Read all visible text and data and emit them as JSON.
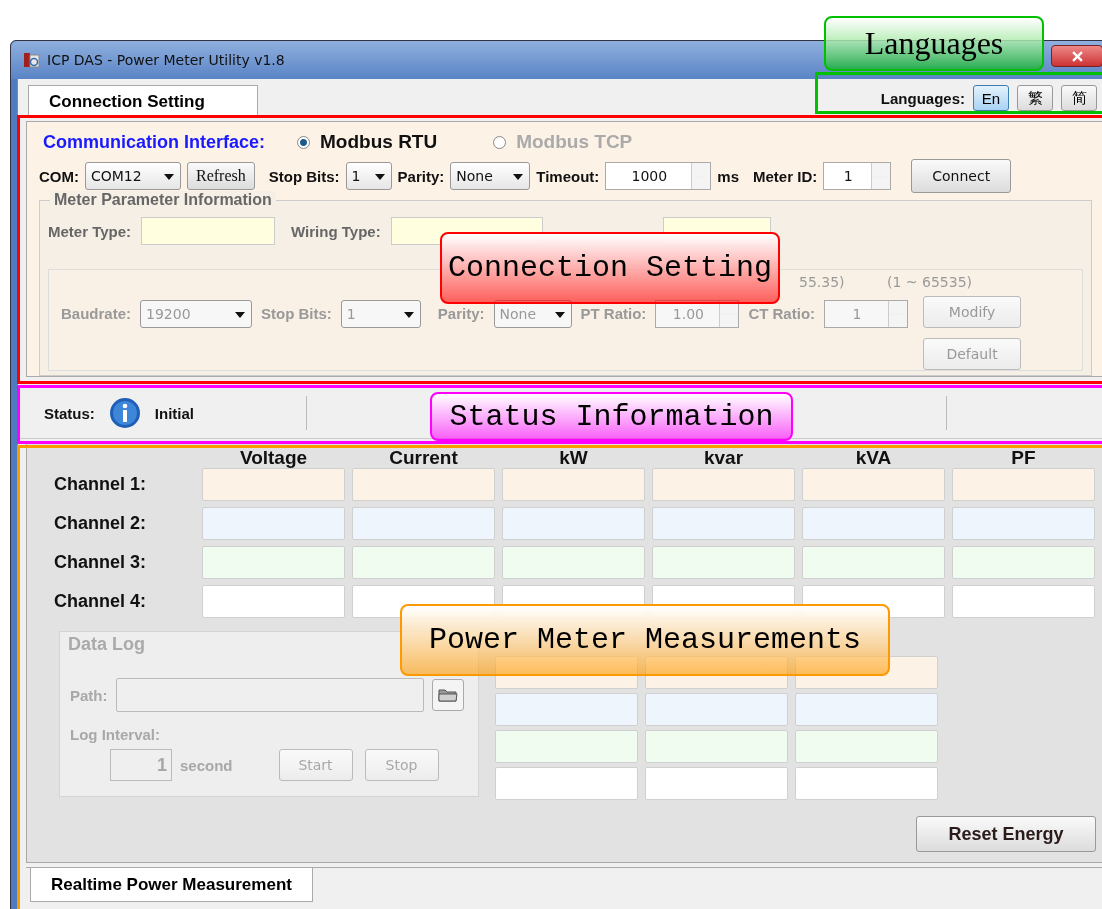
{
  "window": {
    "title": "ICP DAS  -  Power Meter Utility v1.8"
  },
  "top_tabs": [
    {
      "label": "Connection Setting",
      "selected": true
    }
  ],
  "languages": {
    "label": "Languages:",
    "options": [
      {
        "label": "En",
        "selected": true
      },
      {
        "label": "繁",
        "selected": false
      },
      {
        "label": "简",
        "selected": false
      }
    ]
  },
  "communication": {
    "label": "Communication Interface:",
    "options": [
      {
        "label": "Modbus RTU",
        "selected": true,
        "disabled": false
      },
      {
        "label": "Modbus TCP",
        "selected": false,
        "disabled": true
      }
    ]
  },
  "connection": {
    "com_label": "COM:",
    "com_value": "COM12",
    "refresh": "Refresh",
    "stop_bits_label": "Stop Bits:",
    "stop_bits_value": "1",
    "parity_label": "Parity:",
    "parity_value": "None",
    "timeout_label": "Timeout:",
    "timeout_value": "1000",
    "timeout_unit": "ms",
    "meter_id_label": "Meter ID:",
    "meter_id_value": "1",
    "connect": "Connect"
  },
  "meter_parameter": {
    "title": "Meter Parameter Information",
    "meter_type_label": "Meter Type:",
    "wiring_type_label": "Wiring Type:",
    "settings": {
      "disabled": true,
      "baudrate_label": "Baudrate:",
      "baudrate_value": "19200",
      "stop_bits_label": "Stop Bits:",
      "stop_bits_value": "1",
      "parity_label": "Parity:",
      "parity_value": "None",
      "pt_range": "55.35)",
      "pt_label": "PT Ratio:",
      "pt_value": "1.00",
      "ct_range": "(1 ~ 65535)",
      "ct_label": "CT Ratio:",
      "ct_value": "1",
      "modify": "Modify",
      "default": "Default"
    }
  },
  "status": {
    "label": "Status:",
    "value": "Initial"
  },
  "measurements": {
    "columns": [
      "Voltage",
      "Current",
      "kW",
      "kvar",
      "kVA",
      "PF"
    ],
    "rows": [
      {
        "label": "Channel 1:",
        "color": "#fcf3e6"
      },
      {
        "label": "Channel 2:",
        "color": "#eef5fc"
      },
      {
        "label": "Channel 3:",
        "color": "#effcef"
      },
      {
        "label": "Channel 4:",
        "color": "#ffffff"
      }
    ]
  },
  "data_log": {
    "title": "Data Log",
    "disabled": true,
    "path_label": "Path:",
    "interval_label": "Log Interval:",
    "interval_value": "1",
    "interval_unit": "second",
    "start": "Start",
    "stop": "Stop"
  },
  "reset_button": "Reset Energy",
  "bottom_tabs": [
    {
      "label": "Realtime Power Measurement",
      "selected": true
    }
  ],
  "callouts": [
    {
      "label": "Languages",
      "color": "#00c000"
    },
    {
      "label": "Connection Setting",
      "color": "#ff0000"
    },
    {
      "label": "Status Information",
      "color": "#ff00ff"
    },
    {
      "label": "Power Meter Measurements",
      "color": "#ff9900"
    }
  ]
}
